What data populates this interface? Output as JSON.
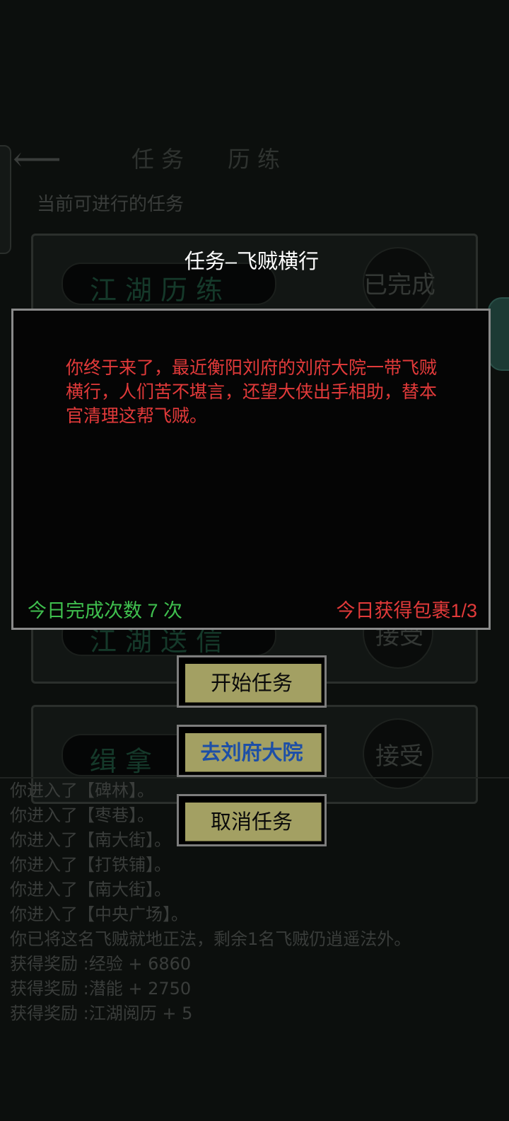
{
  "background": {
    "nav_tabs": [
      "任务",
      "历练"
    ],
    "section_title": "当前可进行的任务",
    "cards": [
      {
        "name": "江湖历练",
        "action": "已完成"
      },
      {
        "name": "江湖送信",
        "action": "接受"
      },
      {
        "name": "缉拿",
        "action": "接受"
      }
    ],
    "log": [
      "你进入了【碑林】。",
      "你进入了【枣巷】。",
      "你进入了【南大街】。",
      "你进入了【打铁铺】。",
      "你进入了【南大街】。",
      "你进入了【中央广场】。",
      "你已将这名飞贼就地正法，剩余1名飞贼仍逍遥法外。",
      "获得奖励 :经验 + 6860",
      "获得奖励 :潜能 + 2750",
      "获得奖励 :江湖阅历 + 5"
    ]
  },
  "dialog": {
    "title": "任务–飞贼横行",
    "description": "你终于来了，最近衡阳刘府的刘府大院一带飞贼横行，人们苦不堪言，还望大侠出手相助，替本官清理这帮飞贼。",
    "completed_today": "今日完成次数 7 次",
    "packages_today": "今日获得包裹1/3"
  },
  "buttons": {
    "start": "开始任务",
    "goto": "去刘府大院",
    "cancel": "取消任务"
  },
  "colors": {
    "description_text": "#e23a3a",
    "completed_text": "#3fbf4e",
    "button_face": "#a3a063",
    "goto_text": "#1d4fa6"
  }
}
